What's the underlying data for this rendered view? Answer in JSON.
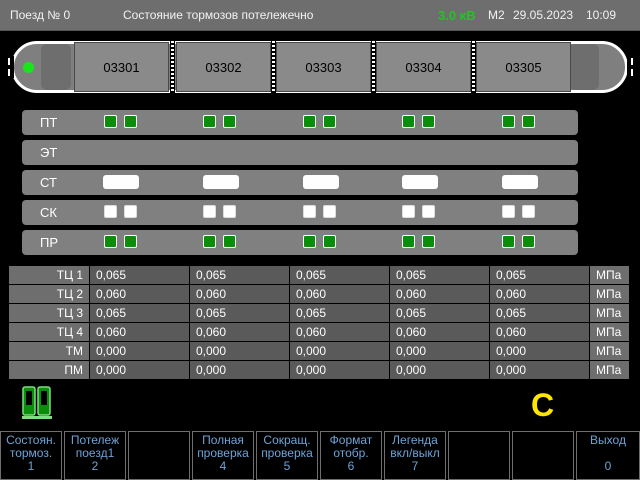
{
  "header": {
    "train": "Поезд № 0",
    "title": "Состояние тормозов потележечно",
    "voltage": "3.0 кВ",
    "mode": "М2",
    "date": "29.05.2023",
    "time": "10:09"
  },
  "cars": [
    "03301",
    "03302",
    "03303",
    "03304",
    "03305"
  ],
  "rows": {
    "pt": "ПТ",
    "et": "ЭТ",
    "st": "СТ",
    "sk": "СК",
    "pr": "ПР"
  },
  "pressure": {
    "unit": "МПа",
    "rows": [
      {
        "label": "ТЦ 1",
        "values": [
          "0,065",
          "0,065",
          "0,065",
          "0,065",
          "0,065"
        ]
      },
      {
        "label": "ТЦ 2",
        "values": [
          "0,060",
          "0,060",
          "0,060",
          "0,060",
          "0,060"
        ]
      },
      {
        "label": "ТЦ 3",
        "values": [
          "0,065",
          "0,065",
          "0,065",
          "0,065",
          "0,065"
        ]
      },
      {
        "label": "ТЦ 4",
        "values": [
          "0,060",
          "0,060",
          "0,060",
          "0,060",
          "0,060"
        ]
      },
      {
        "label": "ТМ",
        "values": [
          "0,000",
          "0,000",
          "0,000",
          "0,000",
          "0,000"
        ]
      },
      {
        "label": "ПМ",
        "values": [
          "0,000",
          "0,000",
          "0,000",
          "0,000",
          "0,000"
        ]
      }
    ]
  },
  "indicator": {
    "letter": "C"
  },
  "fkeys": [
    {
      "l1": "Состоян.",
      "l2": "тормоз.",
      "num": "1"
    },
    {
      "l1": "Потележ",
      "l2": "поезд1",
      "num": "2"
    },
    {
      "l1": "",
      "l2": "",
      "num": ""
    },
    {
      "l1": "Полная",
      "l2": "проверка",
      "num": "4"
    },
    {
      "l1": "Сокращ.",
      "l2": "проверка",
      "num": "5"
    },
    {
      "l1": "Формат",
      "l2": "отобр.",
      "num": "6"
    },
    {
      "l1": "Легенда",
      "l2": "вкл/выкл",
      "num": "7"
    },
    {
      "l1": "",
      "l2": "",
      "num": ""
    },
    {
      "l1": "",
      "l2": "",
      "num": ""
    },
    {
      "l1": "Выход",
      "l2": "",
      "num": "0"
    }
  ],
  "colors": {
    "green_indicator": "#0a8e0a",
    "voltage": "#22c51e",
    "accent_letter": "#ffe600",
    "fkey_text": "#6ea3d8"
  }
}
